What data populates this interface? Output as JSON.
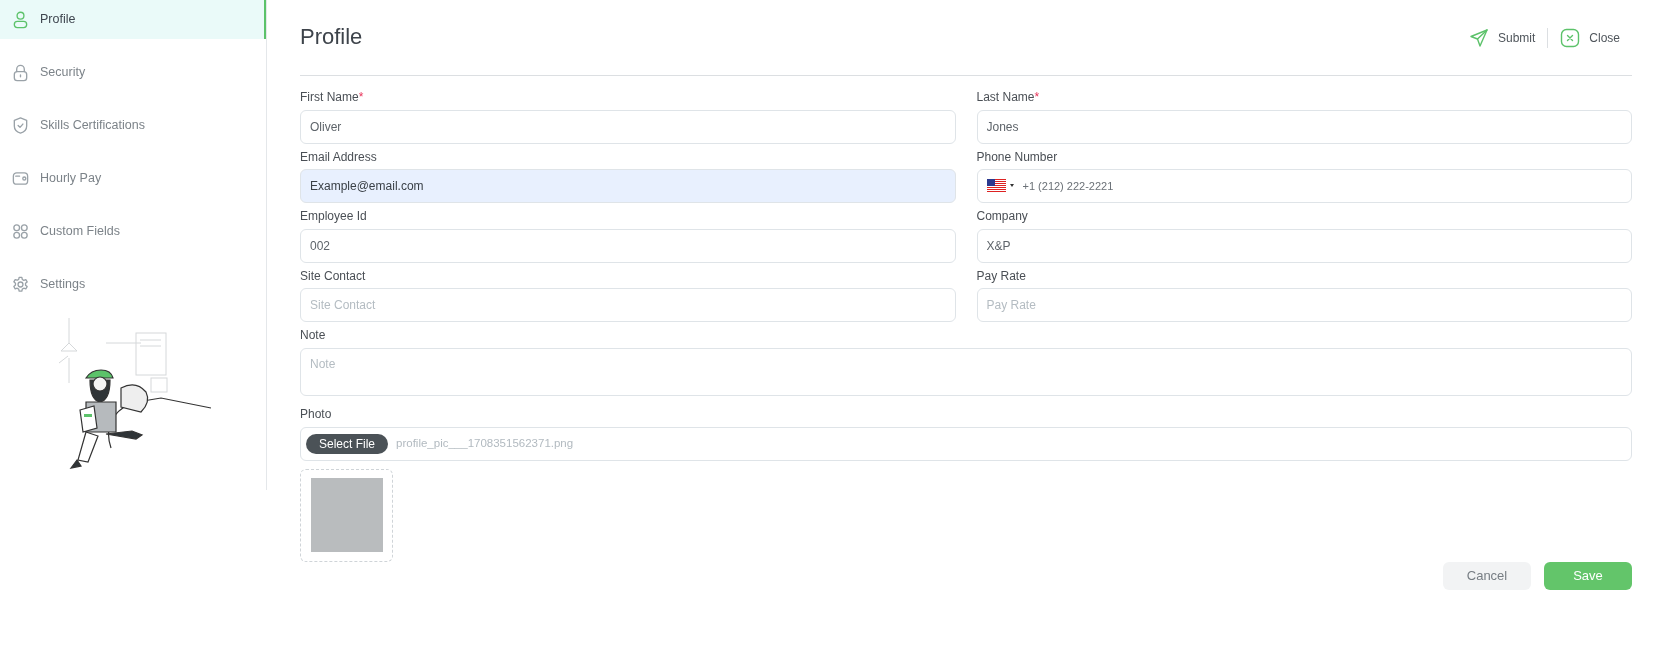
{
  "sidebar": {
    "items": [
      {
        "label": "Profile",
        "selected": true
      },
      {
        "label": "Security",
        "selected": false
      },
      {
        "label": "Skills Certifications",
        "selected": false
      },
      {
        "label": "Hourly Pay",
        "selected": false
      },
      {
        "label": "Custom Fields",
        "selected": false
      },
      {
        "label": "Settings",
        "selected": false
      }
    ]
  },
  "header": {
    "title": "Profile",
    "actions": [
      {
        "label": "Submit",
        "kind": "submit"
      },
      {
        "label": "Close",
        "kind": "close"
      }
    ]
  },
  "fields": [
    {
      "kind": "text",
      "label": "First Name",
      "required_mark": "*",
      "value": "Oliver"
    },
    {
      "kind": "text",
      "label": "Last Name",
      "required_mark": "*",
      "value": "Jones"
    },
    {
      "kind": "text",
      "label": "Email Address",
      "value": "Example@email.com",
      "autofilled": true
    },
    {
      "kind": "phone",
      "label": "Phone Number",
      "value": "+1 (212) 222-2221"
    },
    {
      "kind": "text",
      "label": "Employee Id",
      "value": "002"
    },
    {
      "kind": "text",
      "label": "Company",
      "value": "X&P"
    },
    {
      "kind": "text",
      "label": "Site Contact",
      "placeholder": "Site Contact"
    },
    {
      "kind": "text",
      "label": "Pay Rate",
      "placeholder": "Pay Rate"
    },
    {
      "kind": "textarea",
      "label": "Note",
      "placeholder": "Note"
    },
    {
      "kind": "file",
      "label": "Photo",
      "button": "Select File",
      "file_name": "profile_pic___1708351562371.png"
    }
  ],
  "footer": {
    "buttons": [
      {
        "label": "Cancel",
        "kind": "secondary"
      },
      {
        "label": "Save",
        "kind": "primary"
      }
    ]
  }
}
